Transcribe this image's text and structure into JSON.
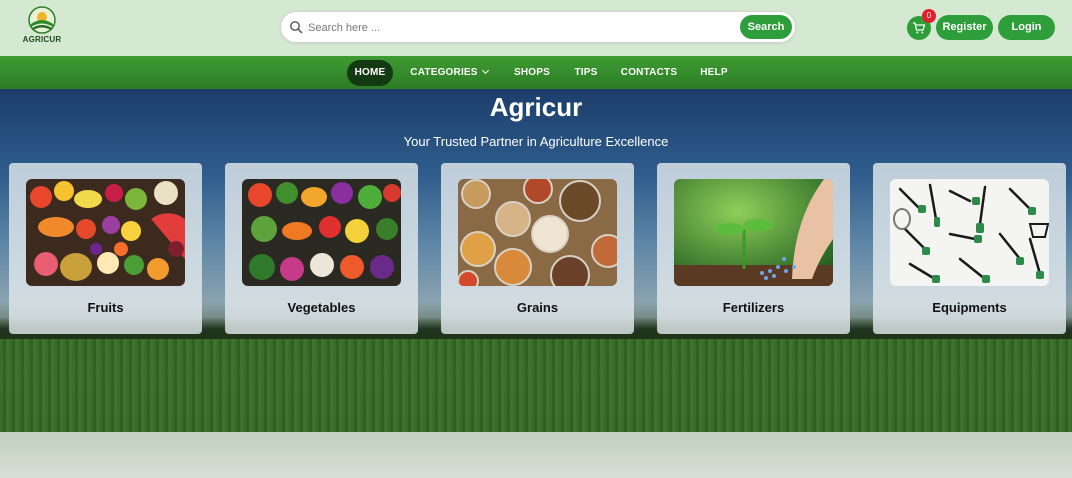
{
  "header": {
    "logo_text": "AGRICUR",
    "search": {
      "placeholder": "Search here ...",
      "button_label": "Search"
    },
    "cart": {
      "icon": "cart-icon",
      "count": "0"
    },
    "register_label": "Register",
    "login_label": "Login"
  },
  "nav": {
    "items": [
      {
        "label": "HOME",
        "active": true
      },
      {
        "label": "CATEGORIES",
        "dropdown": true
      },
      {
        "label": "SHOPS"
      },
      {
        "label": "TIPS"
      },
      {
        "label": "CONTACTS"
      },
      {
        "label": "HELP"
      }
    ]
  },
  "hero": {
    "title": "Agricur",
    "subtitle": "Your Trusted Partner in Agriculture Excellence"
  },
  "categories": [
    {
      "label": "Fruits",
      "image": "fruits-image"
    },
    {
      "label": "Vegetables",
      "image": "vegetables-image"
    },
    {
      "label": "Grains",
      "image": "grains-image"
    },
    {
      "label": "Fertilizers",
      "image": "fertilizers-image"
    },
    {
      "label": "Equipments",
      "image": "equipments-image"
    }
  ],
  "colors": {
    "brand_green": "#2e9e3a",
    "nav_active": "#133a12",
    "badge_red": "#e2202c",
    "header_bg": "#d5e8d2"
  }
}
